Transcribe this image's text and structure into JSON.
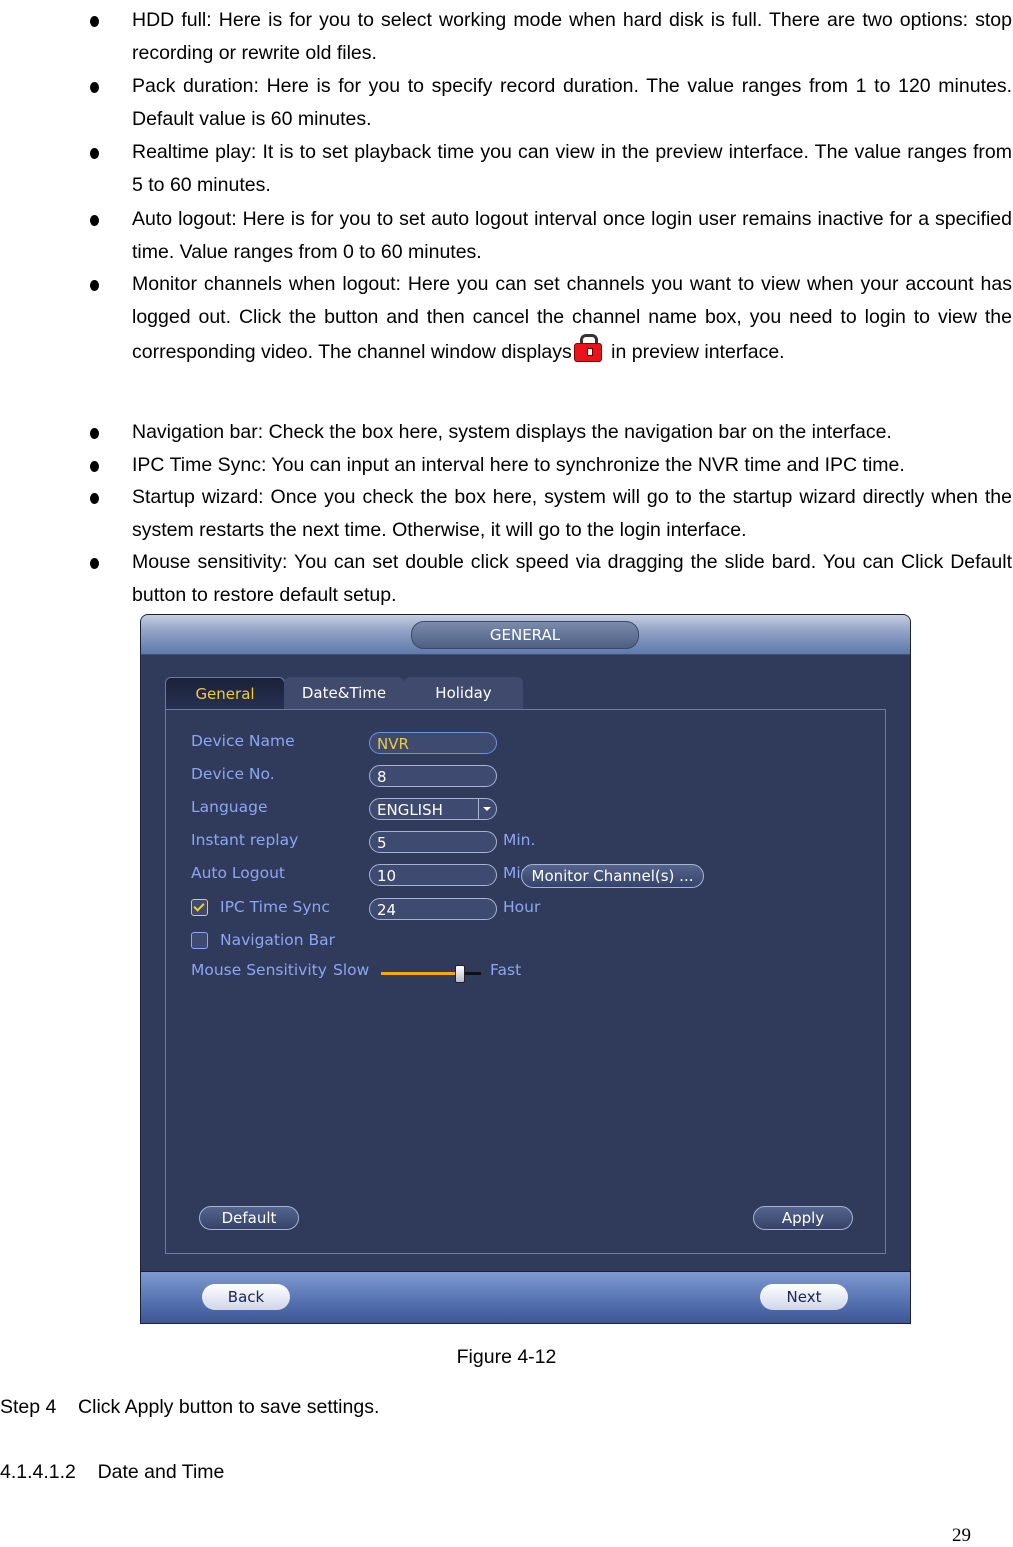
{
  "bullets": [
    {
      "text": "HDD full: Here is for you to select working mode when hard disk is full. There are two options: stop recording or rewrite old files."
    },
    {
      "text": "Pack duration: Here is for you to specify record duration. The value ranges from 1 to 120 minutes. Default value is 60 minutes."
    },
    {
      "text": "Realtime play: It is to set playback time you can view in the preview interface. The value ranges from 5 to 60 minutes."
    },
    {
      "text": "Auto logout: Here is for you to set auto logout interval once login user remains inactive for a specified time. Value ranges from 0 to 60 minutes."
    },
    {
      "text_before_icon": "Monitor channels when logout: Here you can set channels you want to view when your account has logged out. Click the button and then cancel the channel name box, you need to login to view the corresponding video. The channel window displays",
      "icon": "lock-icon",
      "text_after_icon": " in preview interface."
    },
    {
      "text": "Navigation bar: Check the box here, system displays the navigation bar on the interface."
    },
    {
      "text": "IPC Time Sync: You can input an interval here to synchronize the NVR time and IPC time."
    },
    {
      "text": "Startup wizard: Once you check the box here, system will go to the startup wizard directly when the system restarts the next time. Otherwise, it will go to the login interface."
    },
    {
      "text": "Mouse sensitivity: You can set double click speed via dragging the slide bard. You can Click Default button to restore default setup."
    }
  ],
  "ui": {
    "title": "GENERAL",
    "tabs": [
      {
        "label": "General",
        "active": true
      },
      {
        "label": "Date&Time",
        "active": false
      },
      {
        "label": "Holiday",
        "active": false
      }
    ],
    "fields": {
      "device_name": {
        "label": "Device Name",
        "value": "NVR"
      },
      "device_no": {
        "label": "Device No.",
        "value": "8"
      },
      "language": {
        "label": "Language",
        "value": "ENGLISH"
      },
      "instant_replay": {
        "label": "Instant replay",
        "value": "5",
        "unit": "Min."
      },
      "auto_logout": {
        "label": "Auto Logout",
        "value": "10",
        "unit": "Min."
      },
      "ipc_time_sync": {
        "label": "IPC Time Sync",
        "checked": true,
        "value": "24",
        "unit": "Hour"
      },
      "navigation_bar": {
        "label": "Navigation Bar",
        "checked": false
      },
      "mouse_sensitivity": {
        "label": "Mouse Sensitivity",
        "slow_label": "Slow",
        "fast_label": "Fast",
        "value_percent": 78
      }
    },
    "monitor_channels_button": "Monitor Channel(s) ...",
    "default_button": "Default",
    "apply_button": "Apply",
    "back_button": "Back",
    "next_button": "Next",
    "accent_color": "#f3cc35",
    "label_color": "#8ea6f2"
  },
  "caption": "Figure 4-12",
  "step": "Step 4    Click Apply button to save settings.",
  "section": "4.1.4.1.2    Date and Time",
  "page_number": "29"
}
